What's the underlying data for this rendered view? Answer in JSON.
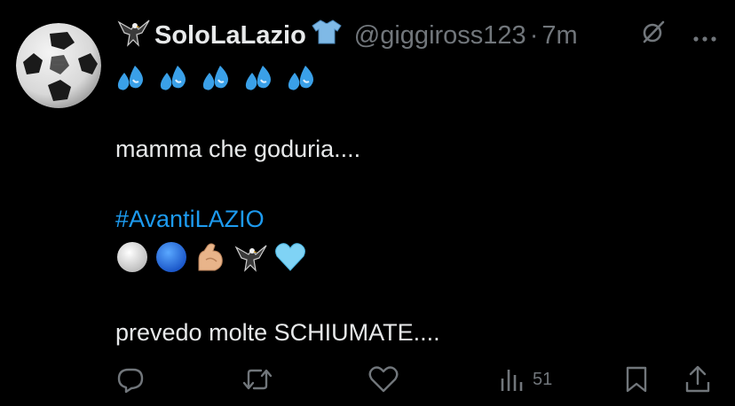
{
  "tweet": {
    "display_name": "SoloLaLazio",
    "handle": "@giggiross123",
    "separator": "·",
    "time": "7m",
    "line1": "mamma che goduria....",
    "hashtag": "#AvantiLAZIO",
    "line3": "prevedo molte SCHIUMATE...."
  },
  "actions": {
    "views_count": "51"
  },
  "colors": {
    "background": "#000000",
    "text": "#e7e9ea",
    "muted": "#71767b",
    "link": "#1d9bf0"
  },
  "icons": {
    "name_prefix": "eagle-icon",
    "name_suffix": "shirt-icon",
    "emoji_row1": [
      "sweat-droplets-icon",
      "sweat-droplets-icon",
      "sweat-droplets-icon",
      "sweat-droplets-icon",
      "sweat-droplets-icon"
    ],
    "emoji_row2": [
      "white-circle-icon",
      "blue-circle-icon",
      "flexed-biceps-icon",
      "eagle-icon",
      "light-blue-heart-icon"
    ]
  }
}
